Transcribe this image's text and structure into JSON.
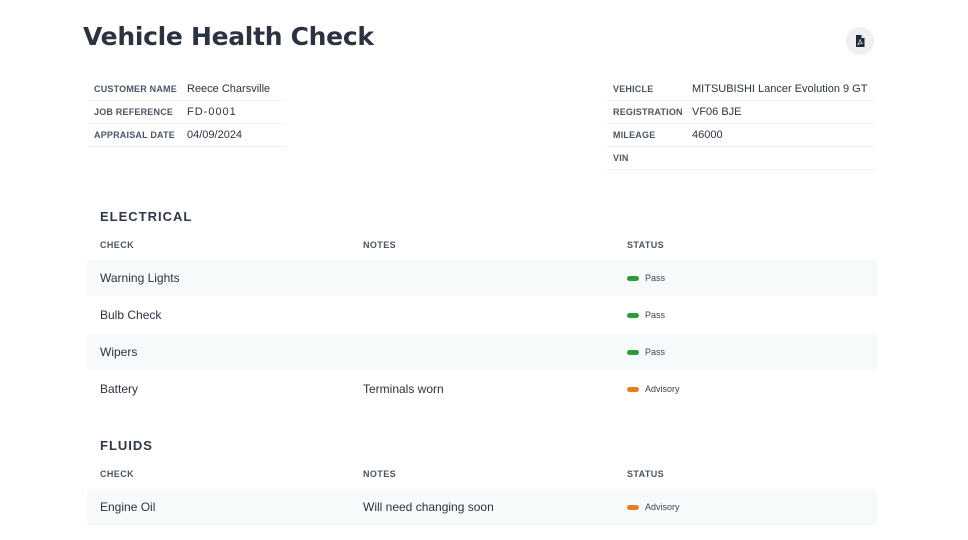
{
  "header": {
    "title": "Vehicle Health Check",
    "export_icon": "pdf-file-icon"
  },
  "info_left": [
    {
      "label": "CUSTOMER NAME",
      "value": "Reece Charsville"
    },
    {
      "label": "JOB REFERENCE",
      "value": "FD-0001"
    },
    {
      "label": "APPRAISAL DATE",
      "value": "04/09/2024"
    }
  ],
  "info_right": [
    {
      "label": "VEHICLE",
      "value": "MITSUBISHI Lancer Evolution 9 GT"
    },
    {
      "label": "REGISTRATION",
      "value": "VF06 BJE"
    },
    {
      "label": "MILEAGE",
      "value": "46000"
    },
    {
      "label": "VIN",
      "value": ""
    }
  ],
  "colors": {
    "pass": "#2e9a3a",
    "advisory": "#e57f1f",
    "row_shade": "#f6fafb"
  },
  "sections": [
    {
      "title": "ELECTRICAL",
      "headers": {
        "check": "CHECK",
        "notes": "NOTES",
        "status": "STATUS"
      },
      "rows": [
        {
          "check": "Warning Lights",
          "notes": "",
          "status": "Pass",
          "status_color": "#2e9a3a"
        },
        {
          "check": "Bulb Check",
          "notes": "",
          "status": "Pass",
          "status_color": "#2e9a3a"
        },
        {
          "check": "Wipers",
          "notes": "",
          "status": "Pass",
          "status_color": "#2e9a3a"
        },
        {
          "check": "Battery",
          "notes": "Terminals worn",
          "status": "Advisory",
          "status_color": "#e57f1f"
        }
      ]
    },
    {
      "title": "FLUIDS",
      "headers": {
        "check": "CHECK",
        "notes": "NOTES",
        "status": "STATUS"
      },
      "rows": [
        {
          "check": "Engine Oil",
          "notes": "Will need changing soon",
          "status": "Advisory",
          "status_color": "#e57f1f"
        }
      ]
    }
  ]
}
